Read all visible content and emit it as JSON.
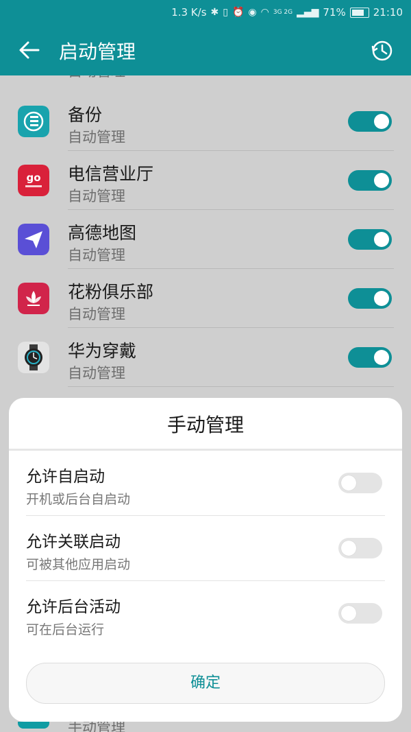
{
  "status_bar": {
    "speed": "1.3 K/s",
    "battery": "71%",
    "time": "21:10",
    "network": "3G 2G"
  },
  "app_bar": {
    "title": "启动管理",
    "back_icon": "back-arrow-icon",
    "history_icon": "history-clock-icon"
  },
  "list": {
    "partial_top": {
      "sub": "自动管理"
    },
    "items": [
      {
        "name": "备份",
        "sub": "自动管理",
        "icon": "backup-icon",
        "enabled": true,
        "color": "#19a3ad"
      },
      {
        "name": "电信营业厅",
        "sub": "自动管理",
        "icon": "telecom-ego-icon",
        "enabled": true,
        "color": "#d9213a"
      },
      {
        "name": "高德地图",
        "sub": "自动管理",
        "icon": "amap-icon",
        "enabled": true,
        "color": "#5a4fd6"
      },
      {
        "name": "花粉俱乐部",
        "sub": "自动管理",
        "icon": "huafen-club-icon",
        "enabled": true,
        "color": "#d1244a"
      },
      {
        "name": "华为穿戴",
        "sub": "自动管理",
        "icon": "huawei-wear-icon",
        "enabled": true,
        "color": "#e3e3e3"
      }
    ],
    "partial_bottom": {
      "sub": "手动管理"
    }
  },
  "dialog": {
    "title": "手动管理",
    "options": [
      {
        "name": "允许自启动",
        "sub": "开机或后台自启动",
        "enabled": false
      },
      {
        "name": "允许关联启动",
        "sub": "可被其他应用启动",
        "enabled": false
      },
      {
        "name": "允许后台活动",
        "sub": "可在后台运行",
        "enabled": false
      }
    ],
    "confirm_label": "确定"
  },
  "colors": {
    "accent": "#0e8f96",
    "toggle_on": "#0e8f96",
    "toggle_off": "#e4e4e4"
  }
}
